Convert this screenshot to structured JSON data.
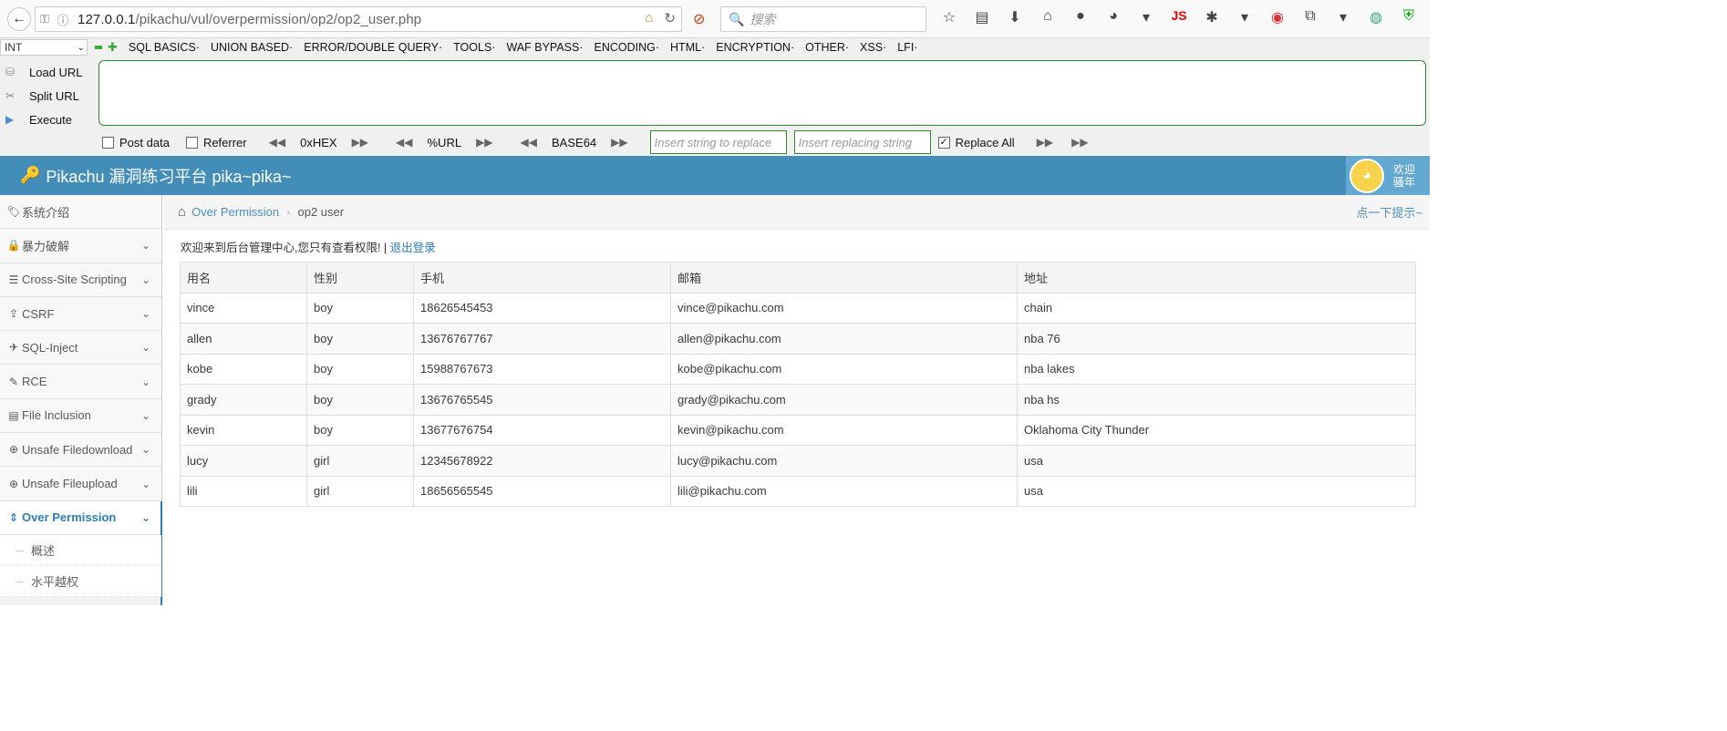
{
  "browser": {
    "url_host": "127.0.0.1",
    "url_path": "/pikachu/vul/overpermission/op2/op2_user.php",
    "search_placeholder": "搜索",
    "js_label": "JS"
  },
  "hackbar": {
    "select_value": "INT",
    "menu": [
      "SQL BASICS·",
      "UNION BASED·",
      "ERROR/DOUBLE QUERY·",
      "TOOLS·",
      "WAF BYPASS·",
      "ENCODING·",
      "HTML·",
      "ENCRYPTION·",
      "OTHER·",
      "XSS·",
      "LFI·"
    ],
    "load_url": "Load URL",
    "split_url": "Split URL",
    "execute": "Execute",
    "post_data": "Post data",
    "referrer": "Referrer",
    "hex": "0xHEX",
    "url_enc": "%URL",
    "base64": "BASE64",
    "replace_placeholder": "Insert string to replace",
    "replacing_placeholder": "Insert replacing string",
    "replace_all": "Replace All"
  },
  "header": {
    "title": "Pikachu 漏洞练习平台 pika~pika~",
    "welcome_line1": "欢迎",
    "welcome_line2": "骚年"
  },
  "sidebar": {
    "items": [
      {
        "label": "系统介绍",
        "icon": "tags-icon"
      },
      {
        "label": "暴力破解",
        "icon": "lock-icon"
      },
      {
        "label": "Cross-Site Scripting",
        "icon": "sliders-icon"
      },
      {
        "label": "CSRF",
        "icon": "share-icon"
      },
      {
        "label": "SQL-Inject",
        "icon": "plane-icon"
      },
      {
        "label": "RCE",
        "icon": "pencil-icon"
      },
      {
        "label": "File Inclusion",
        "icon": "file-icon"
      },
      {
        "label": "Unsafe Filedownload",
        "icon": "download-icon"
      },
      {
        "label": "Unsafe Fileupload",
        "icon": "upload-icon"
      },
      {
        "label": "Over Permission",
        "icon": "text-height-icon"
      }
    ],
    "sub_items": [
      "概述",
      "水平越权"
    ]
  },
  "breadcrumb": {
    "parent": "Over Permission",
    "current": "op2 user",
    "hint": "点一下提示~"
  },
  "notice": {
    "text": "欢迎来到后台管理中心,您只有查看权限! | ",
    "logout": "退出登录"
  },
  "table": {
    "headers": [
      "用名",
      "性别",
      "手机",
      "邮箱",
      "地址"
    ],
    "rows": [
      [
        "vince",
        "boy",
        "18626545453",
        "vince@pikachu.com",
        "chain"
      ],
      [
        "allen",
        "boy",
        "13676767767",
        "allen@pikachu.com",
        "nba 76"
      ],
      [
        "kobe",
        "boy",
        "15988767673",
        "kobe@pikachu.com",
        "nba lakes"
      ],
      [
        "grady",
        "boy",
        "13676765545",
        "grady@pikachu.com",
        "nba hs"
      ],
      [
        "kevin",
        "boy",
        "13677676754",
        "kevin@pikachu.com",
        "Oklahoma City Thunder"
      ],
      [
        "lucy",
        "girl",
        "12345678922",
        "lucy@pikachu.com",
        "usa"
      ],
      [
        "lili",
        "girl",
        "18656565545",
        "lili@pikachu.com",
        "usa"
      ]
    ]
  }
}
